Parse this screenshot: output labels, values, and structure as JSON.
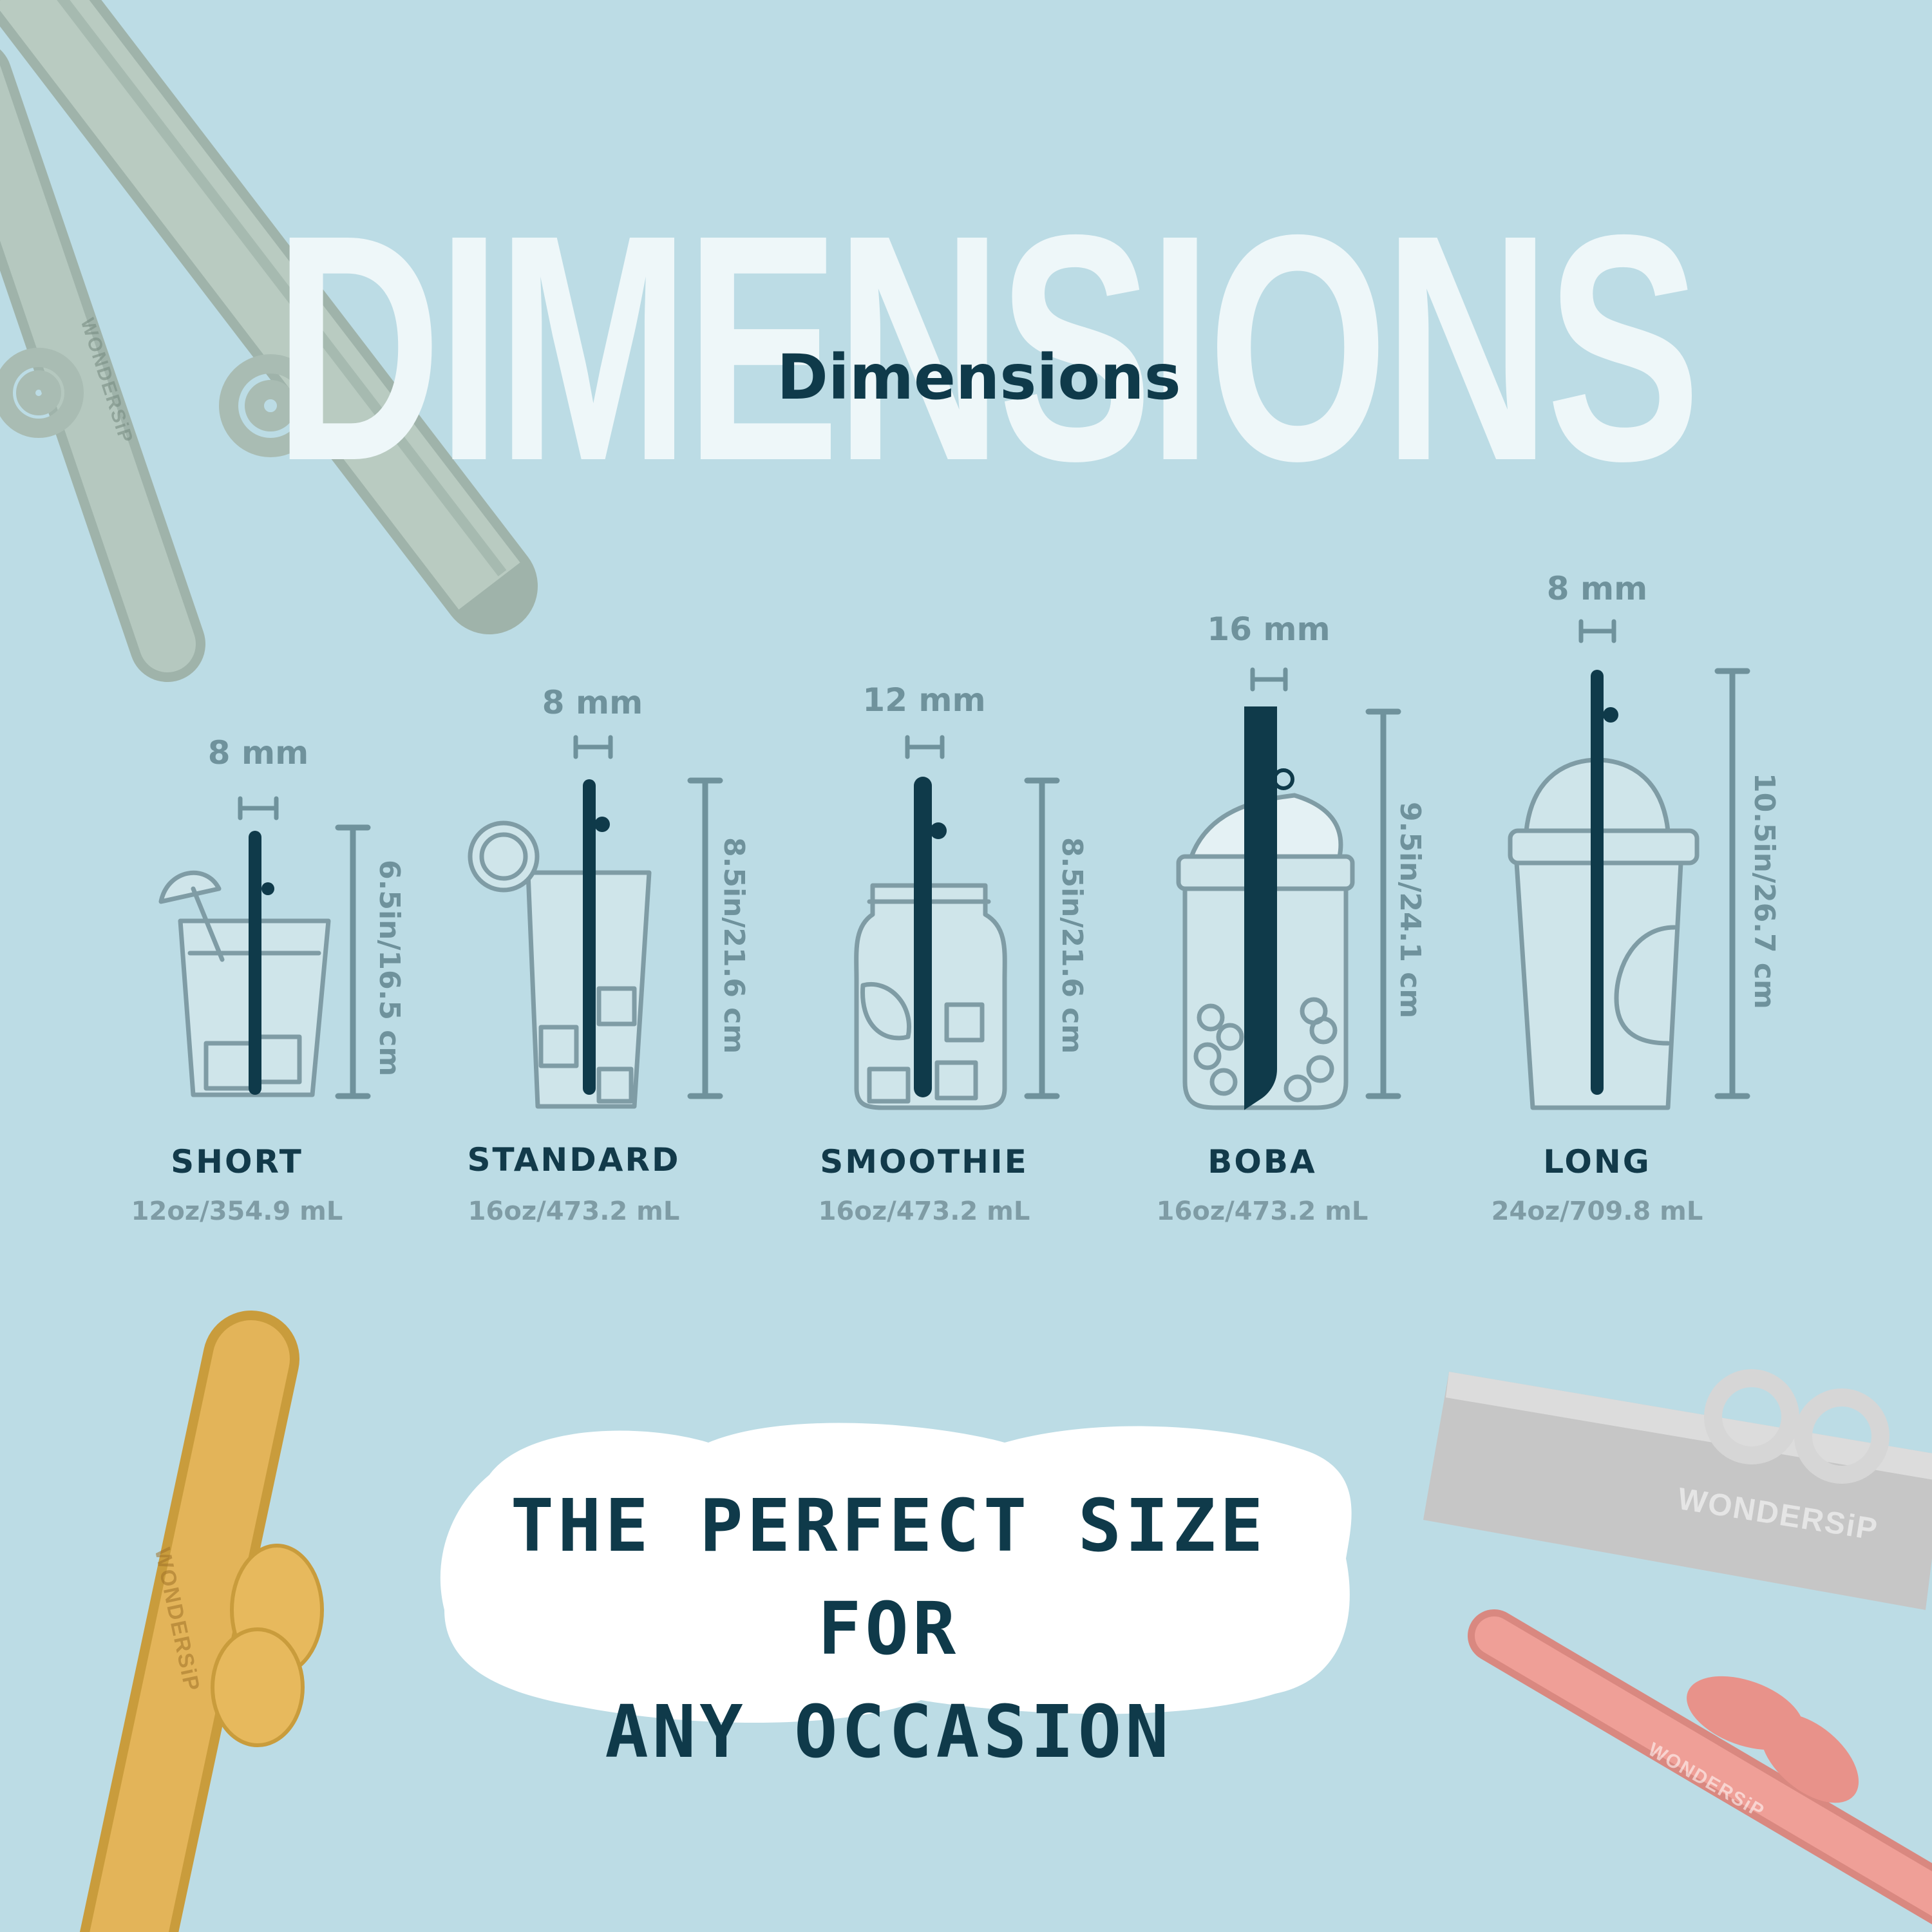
{
  "background_word": "DIMENSIONS",
  "title": "Dimensions",
  "tagline_line1": "THE PERFECT SIZE FOR",
  "tagline_line2": "ANY OCCASION",
  "brand": "WONDERSiP",
  "colors": {
    "background": "#bcdce5",
    "straw": "#0f3a4a",
    "outline": "#7f9ca5",
    "accent_text": "#123a4a"
  },
  "straws": [
    {
      "name": "SHORT",
      "volume": "12oz/354.9 mL",
      "diameter": "8 mm",
      "length": "6.5in/16.5 cm"
    },
    {
      "name": "STANDARD",
      "volume": "16oz/473.2 mL",
      "diameter": "8 mm",
      "length": "8.5in/21.6 cm"
    },
    {
      "name": "SMOOTHIE",
      "volume": "16oz/473.2 mL",
      "diameter": "12 mm",
      "length": "8.5in/21.6 cm"
    },
    {
      "name": "BOBA",
      "volume": "16oz/473.2 mL",
      "diameter": "16 mm",
      "length": "9.5in/24.1 cm"
    },
    {
      "name": "LONG",
      "volume": "24oz/709.8 mL",
      "diameter": "8 mm",
      "length": "10.5in/26.7 cm"
    }
  ]
}
